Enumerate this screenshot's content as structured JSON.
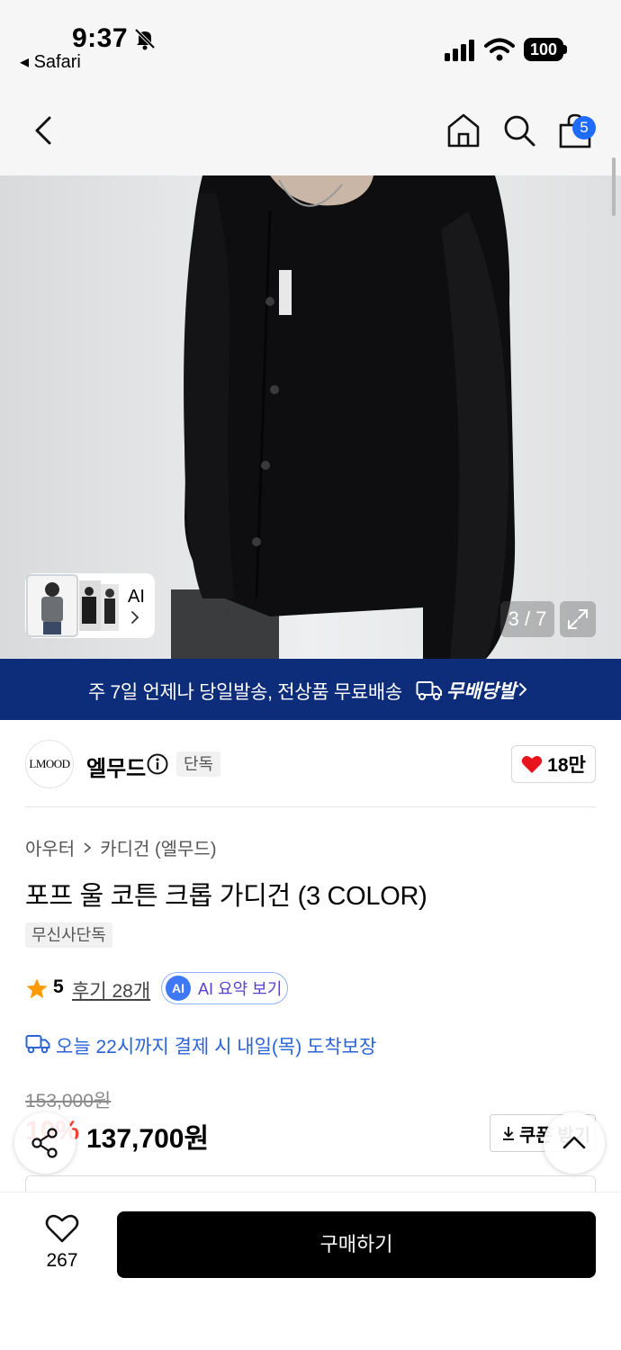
{
  "status_bar": {
    "time": "9:37",
    "back_app": "◂ Safari",
    "battery": "100"
  },
  "nav": {
    "cart_badge": "5",
    "icons": [
      "back-icon",
      "home-icon",
      "search-icon",
      "cart-icon"
    ]
  },
  "gallery": {
    "ai_label": "AI",
    "page_indicator": "3 / 7",
    "current_page": 3,
    "total_pages": 7
  },
  "banner": {
    "text": "주 7일 언제나 당일발송, 전상품 무료배송",
    "logo_text": "무배당발"
  },
  "brand": {
    "logo_text": "LMOOD",
    "name": "엘무드",
    "exclusive_tag": "단독",
    "like_count": "18만"
  },
  "product": {
    "category_parent": "아우터",
    "category_child": "카디건 (엘무드)",
    "title": "포프 울 코튼 크롭 가디건 (3 COLOR)",
    "tag": "무신사단독",
    "rating": "5",
    "reviews": "후기 28개",
    "ai_summary": "AI 요약 보기",
    "ai_badge": "AI",
    "delivery_note": "오늘 22시까지 결제 시 내일(목) 도착보장"
  },
  "price": {
    "original": "153,000원",
    "discount": "10%",
    "sale": "137,700원",
    "coupon": "쿠폰 받기"
  },
  "bottom_bar": {
    "wish_count": "267",
    "buy_label": "구매하기"
  },
  "colors": {
    "banner_bg": "#0d2d7a",
    "accent_blue": "#1f6bff",
    "link_blue": "#2a63d8",
    "discount_red": "#ff3b30",
    "heart_red": "#e8141d",
    "star_orange": "#ff9a00"
  }
}
